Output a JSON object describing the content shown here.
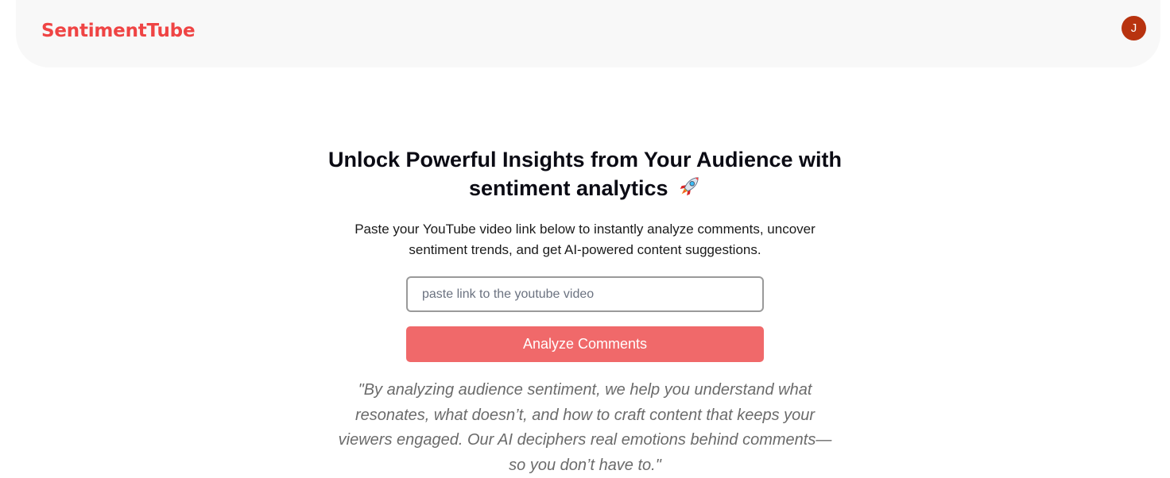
{
  "header": {
    "brand": "SentimentTube",
    "avatar_initial": "J"
  },
  "hero": {
    "title": "Unlock Powerful Insights from Your Audience with sentiment analytics",
    "title_icon": "rocket-icon",
    "subtitle": "Paste your YouTube video link below to instantly analyze comments, uncover sentiment trends, and get AI-powered content suggestions.",
    "input": {
      "value": "",
      "placeholder": "paste link to the youtube video"
    },
    "button_label": "Analyze Comments",
    "quote": "\"By analyzing audience sentiment, we help you understand what resonates, what doesn’t, and how to craft content that keeps your viewers engaged. Our AI deciphers real emotions behind comments—so you don’t have to.\""
  },
  "colors": {
    "brand": "#ef4444",
    "avatar_bg": "#b8330f",
    "button_bg": "#f0696a",
    "navbar_bg": "#f8f8f8"
  }
}
